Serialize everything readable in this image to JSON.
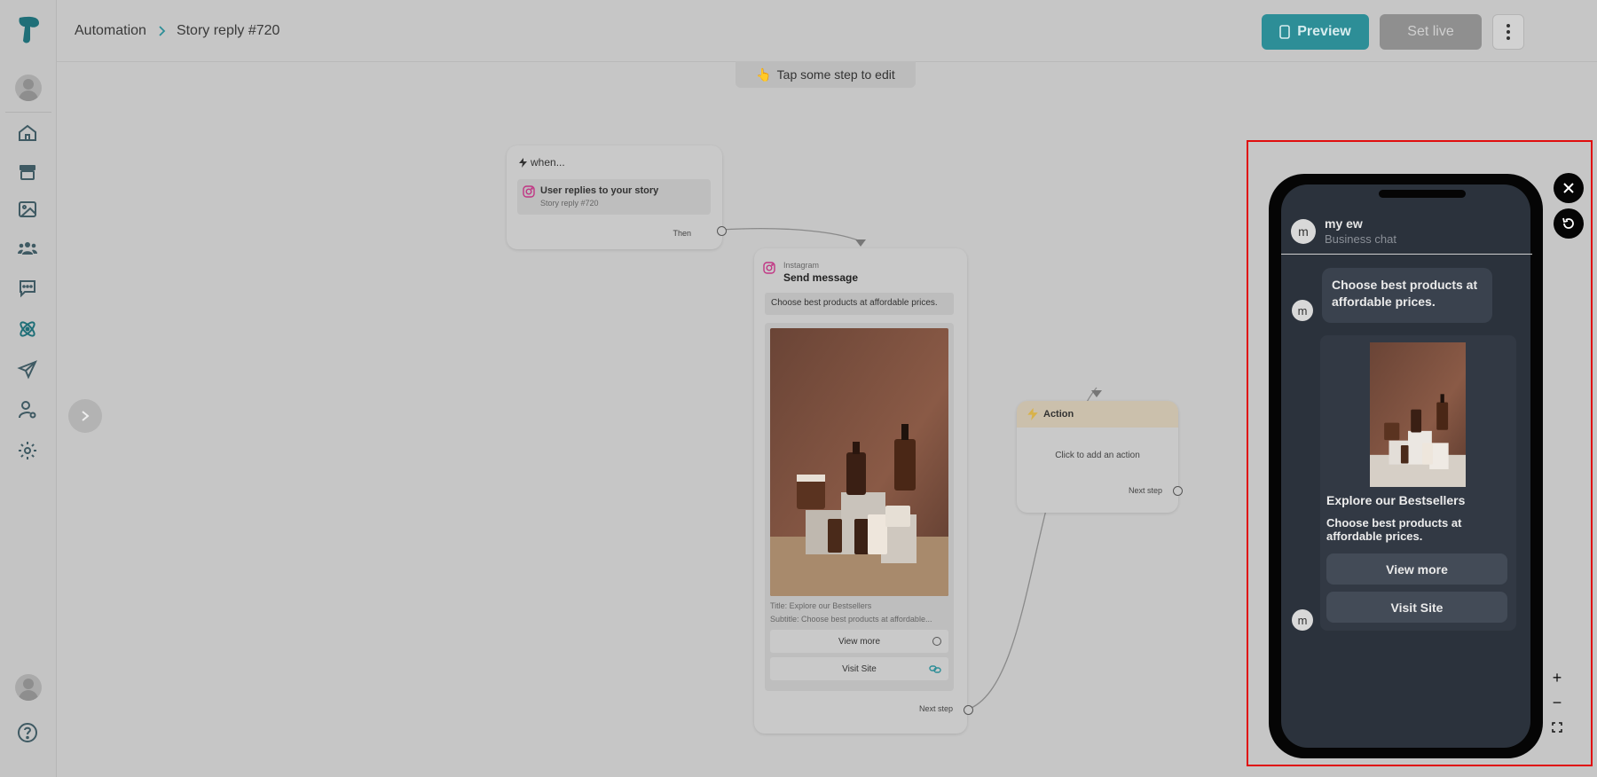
{
  "breadcrumb": {
    "root": "Automation",
    "current": "Story reply #720"
  },
  "toolbar": {
    "preview_label": "Preview",
    "set_live_label": "Set live"
  },
  "hint": {
    "icon": "👆",
    "text": "Tap some step to edit"
  },
  "when_node": {
    "title": "when...",
    "trigger_title": "User replies to your story",
    "trigger_subtitle": "Story reply #720",
    "then_label": "Then"
  },
  "send_node": {
    "platform": "Instagram",
    "title": "Send message",
    "text": "Choose best products at affordable prices.",
    "card_title": "Title: Explore our Bestsellers",
    "card_subtitle": "Subtitle: Choose best products at affordable...",
    "buttons": [
      "View more",
      "Visit Site"
    ],
    "next_label": "Next step"
  },
  "action_node": {
    "title": "Action",
    "body": "Click to add an action",
    "next_label": "Next step"
  },
  "preview": {
    "avatar_letter": "m",
    "chat_name": "my ew",
    "chat_subtitle": "Business chat",
    "message": "Choose best products at affordable prices.",
    "card_title": "Explore our Bestsellers",
    "card_subtitle": "Choose best products at affordable prices.",
    "buttons": [
      "View more",
      "Visit Site"
    ],
    "zoom_in": "+",
    "zoom_out": "−"
  },
  "colors": {
    "accent": "#2d8e97",
    "highlight_frame": "#e00d0d",
    "phone_screen": "#2b323c"
  },
  "icons": [
    "logo-icon",
    "home-icon",
    "store-icon",
    "image-icon",
    "users-icon",
    "chat-icon",
    "automation-icon",
    "send-icon",
    "user-settings-icon",
    "gear-icon",
    "help-icon",
    "close-icon",
    "refresh-icon",
    "fullscreen-icon"
  ]
}
